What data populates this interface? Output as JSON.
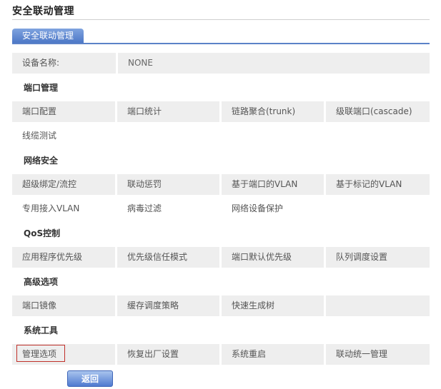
{
  "page": {
    "title": "安全联动管理"
  },
  "tab": {
    "label": "安全联动管理"
  },
  "device": {
    "label": "设备名称:",
    "value": "NONE"
  },
  "sections": {
    "port_mgmt": {
      "heading": "端口管理",
      "items": [
        "端口配置",
        "端口统计",
        "链路聚合(trunk)",
        "级联端口(cascade)",
        "线缆测试"
      ]
    },
    "net_security": {
      "heading": "网络安全",
      "items": [
        "超级绑定/流控",
        "联动惩罚",
        "基于端口的VLAN",
        "基于标记的VLAN",
        "专用接入VLAN",
        "病毒过滤",
        "网络设备保护"
      ]
    },
    "qos": {
      "heading": "QoS控制",
      "items": [
        "应用程序优先级",
        "优先级信任模式",
        "端口默认优先级",
        "队列调度设置"
      ]
    },
    "advanced": {
      "heading": "高级选项",
      "items": [
        "端口镜像",
        "缓存调度策略",
        "快速生成树"
      ]
    },
    "tools": {
      "heading": "系统工具",
      "items": [
        "管理选项",
        "恢复出厂设置",
        "系统重启",
        "联动统一管理"
      ]
    }
  },
  "footer": {
    "back_label": "返回"
  }
}
